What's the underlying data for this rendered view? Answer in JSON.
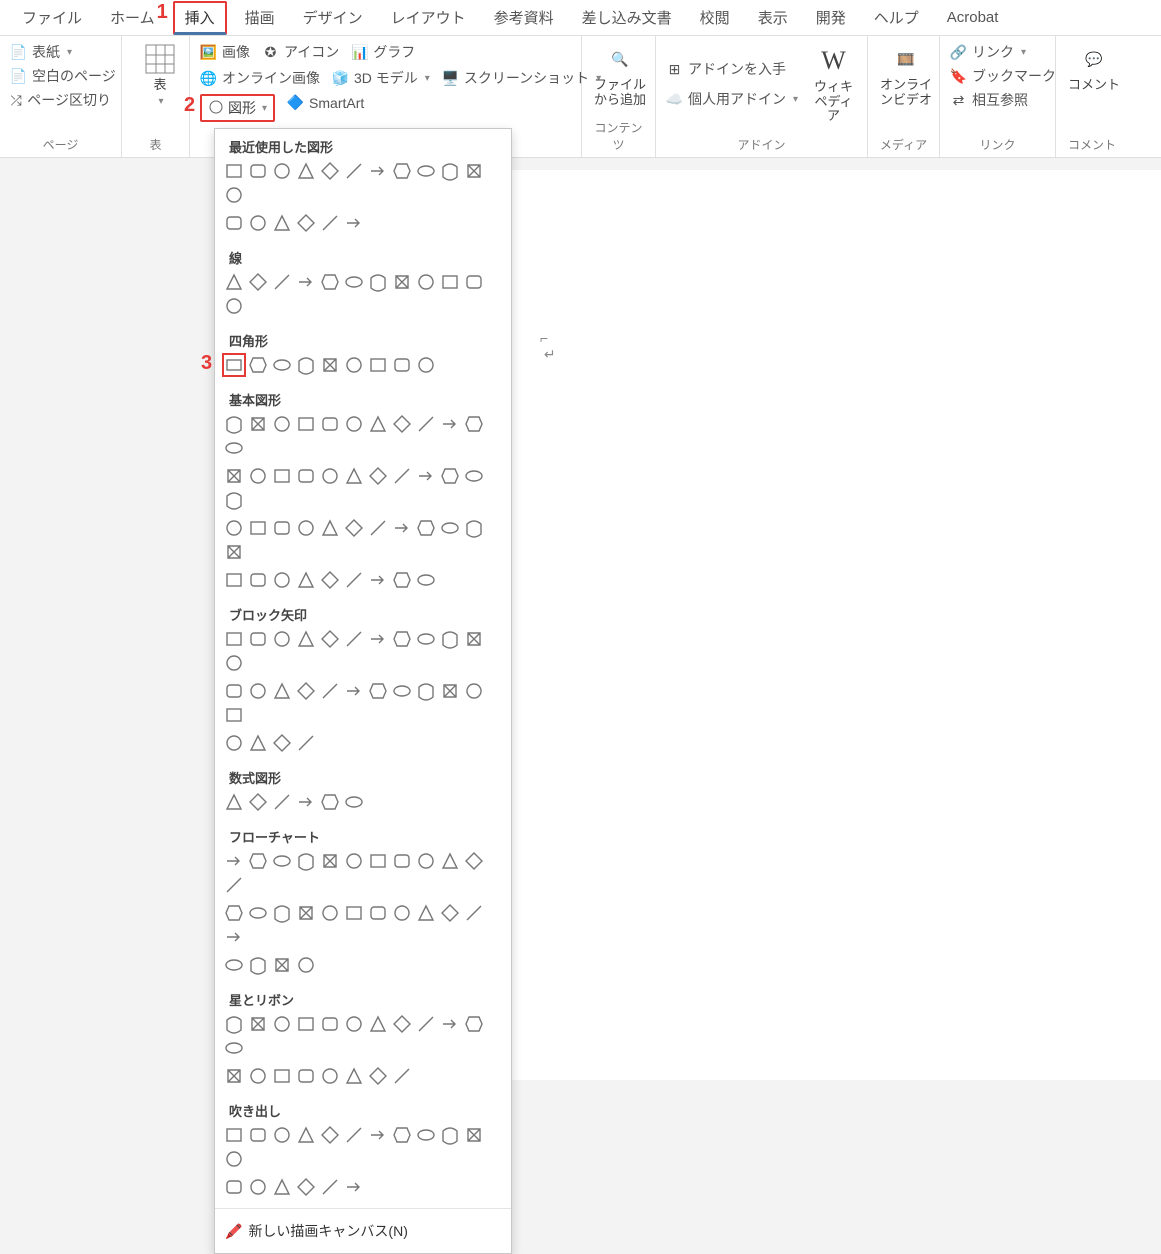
{
  "annotations": {
    "n1": "1",
    "n2": "2",
    "n3": "3"
  },
  "menubar": {
    "tabs": [
      "ファイル",
      "ホーム",
      "挿入",
      "描画",
      "デザイン",
      "レイアウト",
      "参考資料",
      "差し込み文書",
      "校閲",
      "表示",
      "開発",
      "ヘルプ",
      "Acrobat"
    ],
    "active_index": 2
  },
  "ribbon": {
    "groups": {
      "page": {
        "label": "ページ",
        "items": [
          "表紙",
          "空白のページ",
          "ページ区切り"
        ]
      },
      "table": {
        "label": "表",
        "btn": "表"
      },
      "illust": {
        "label": "",
        "items": {
          "image": "画像",
          "online": "オンライン画像",
          "shapes": "図形",
          "icons": "アイコン",
          "model": "3D モデル",
          "smartart": "SmartArt",
          "chart": "グラフ",
          "screenshot": "スクリーンショット"
        }
      },
      "contents": {
        "label": "コンテンツ",
        "btn": "ファイルから追加"
      },
      "addins": {
        "label": "アドイン",
        "get": "アドインを入手",
        "my": "個人用アドイン",
        "wiki": "ウィキペディア"
      },
      "media": {
        "label": "メディア",
        "btn": "オンラインビデオ"
      },
      "links": {
        "label": "リンク",
        "link": "リンク",
        "bookmark": "ブックマーク",
        "crossref": "相互参照"
      },
      "comment": {
        "label": "コメント",
        "btn": "コメント"
      }
    }
  },
  "shapes_dropdown": {
    "categories": [
      {
        "name": "最近使用した図形",
        "counts": [
          12,
          6
        ]
      },
      {
        "name": "線",
        "counts": [
          12
        ]
      },
      {
        "name": "四角形",
        "counts": [
          9
        ]
      },
      {
        "name": "基本図形",
        "counts": [
          12,
          12,
          12,
          9
        ]
      },
      {
        "name": "ブロック矢印",
        "counts": [
          12,
          12,
          4
        ]
      },
      {
        "name": "数式図形",
        "counts": [
          6
        ]
      },
      {
        "name": "フローチャート",
        "counts": [
          12,
          12,
          4
        ]
      },
      {
        "name": "星とリボン",
        "counts": [
          12,
          8
        ]
      },
      {
        "name": "吹き出し",
        "counts": [
          12,
          6
        ]
      }
    ],
    "footer": "新しい描画キャンバス(N)"
  }
}
